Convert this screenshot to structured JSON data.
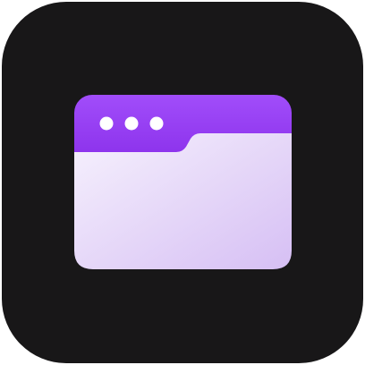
{
  "icon": {
    "name": "browser-window-icon",
    "colors": {
      "tile_background": "#181718",
      "title_bar_top": "#a14dfa",
      "title_bar_bottom": "#8428e6",
      "window_body_light": "#f6f1fd",
      "window_body_dark": "#d6bff4",
      "window_dots": "#ffffff"
    },
    "window_controls": [
      "dot",
      "dot",
      "dot"
    ]
  }
}
